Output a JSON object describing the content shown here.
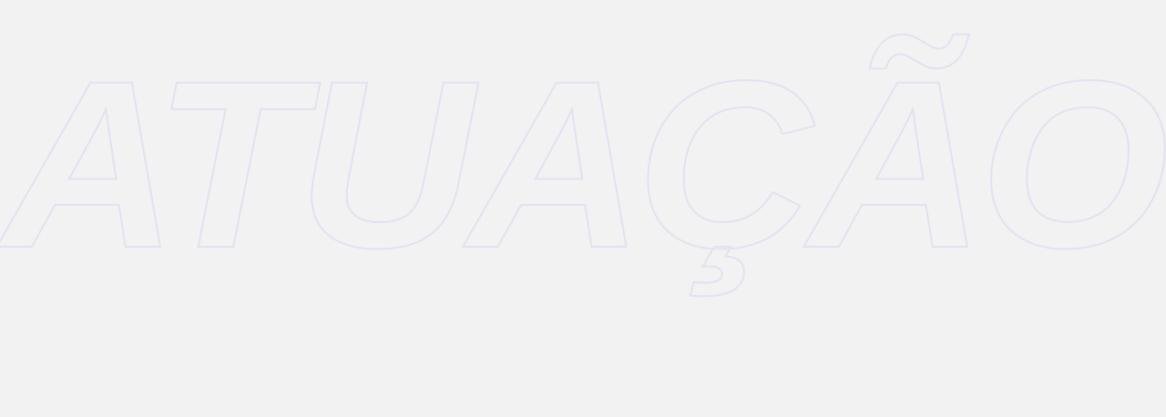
{
  "heading": {
    "text": "ATUAÇÃO",
    "stroke_color": "#e3e1f0",
    "background_color": "#f2f2f2"
  }
}
